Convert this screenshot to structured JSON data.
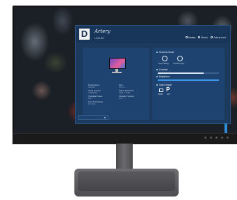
{
  "header": {
    "logo_letter": "D",
    "brand": "Artery",
    "model": "L22i-30",
    "tabs": [
      {
        "label": "Home",
        "active": true
      },
      {
        "label": "Basic",
        "active": false
      },
      {
        "label": "Advanced",
        "active": false
      }
    ]
  },
  "monitor_info": {
    "items_col1": [
      {
        "label": "Model Name",
        "value": "L22i-30"
      },
      {
        "label": "Serial Number",
        "value": "V9050F4E"
      },
      {
        "label": "Charging Power",
        "value": "0W"
      },
      {
        "label": "Sync Technology",
        "value": "No Sync"
      }
    ],
    "items_col2": [
      {
        "label": "Size",
        "value": "21.5 in"
      },
      {
        "label": "Native Resolution",
        "value": "1920 X 1080"
      },
      {
        "label": "Firmware Version",
        "value": "0.0.7"
      }
    ]
  },
  "settings": {
    "scenario_label": "Scenario Mode",
    "modes": [
      {
        "label": "Power Saving",
        "icon": "power-saving-icon"
      },
      {
        "label": "Low Blue Light",
        "icon": "low-blue-light-icon"
      }
    ],
    "contrast_label": "Contrast",
    "contrast_value": 0.75,
    "brightness_label": "Brightness",
    "brightness_value": 1.0,
    "input_label": "Video Signal",
    "inputs": [
      {
        "label": "HDMI1",
        "icon": "hdmi-icon"
      },
      {
        "label": "DP1",
        "icon": "displayport-icon"
      }
    ]
  },
  "colors": {
    "window_bg": "#1c3a5e",
    "panel_bg": "#1f4370",
    "accent": "#3d9be9"
  }
}
